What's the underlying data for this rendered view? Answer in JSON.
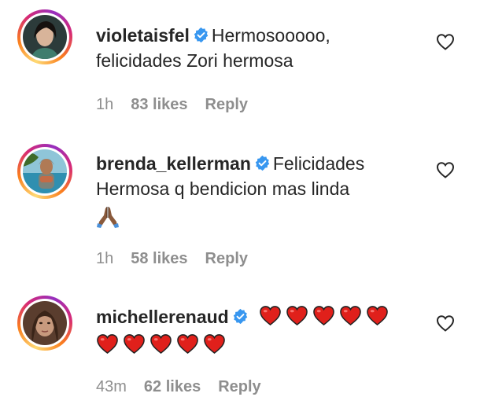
{
  "comments": [
    {
      "username": "violetaisfel",
      "verified": true,
      "text_line1": "Hermosooooo,",
      "text_line2": "felicidades Zori hermosa",
      "time": "1h",
      "likes": "83 likes",
      "reply": "Reply",
      "avatar_colors": [
        "#1f2a2a",
        "#5a7d70"
      ]
    },
    {
      "username": "brenda_kellerman",
      "verified": true,
      "text_line1": "Felicidades",
      "text_line2": "Hermosa q bendicion mas linda",
      "emoji": "folded-hands-icon",
      "time": "1h",
      "likes": "58 likes",
      "reply": "Reply",
      "avatar_colors": [
        "#2f8fb0",
        "#c8a47a"
      ]
    },
    {
      "username": "michellerenaud",
      "verified": true,
      "emoji_line1": [
        "red-heart-icon",
        "red-heart-icon",
        "red-heart-icon",
        "red-heart-icon",
        "red-heart-icon"
      ],
      "emoji_line2": [
        "red-heart-icon",
        "red-heart-icon",
        "red-heart-icon",
        "red-heart-icon",
        "red-heart-icon"
      ],
      "time": "43m",
      "likes": "62 likes",
      "reply": "Reply",
      "avatar_colors": [
        "#6b4a38",
        "#c89a7e"
      ]
    }
  ],
  "colors": {
    "text": "#262626",
    "meta": "#8e8e8e",
    "verified": "#3897f0",
    "heart": "#e0201b"
  }
}
